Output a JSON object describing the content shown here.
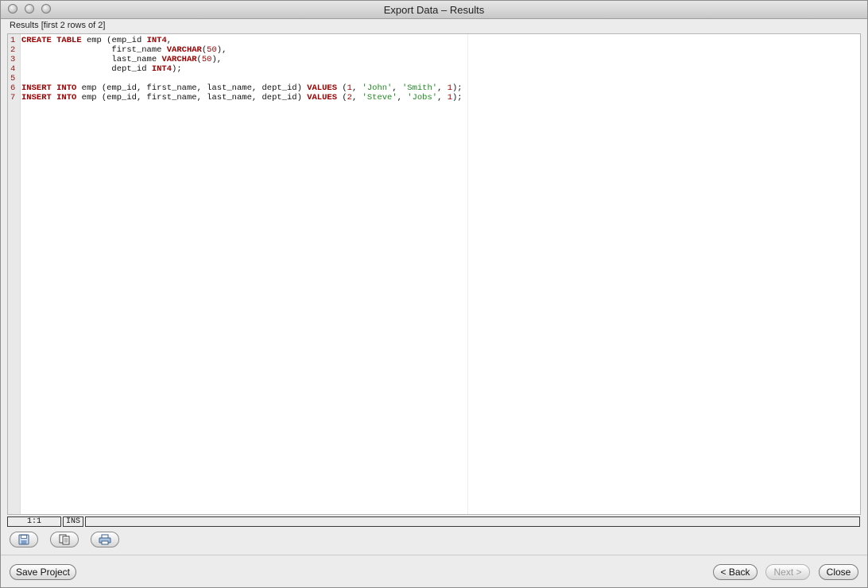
{
  "window": {
    "title": "Export Data – Results"
  },
  "results_label": "Results [first 2 rows of 2]",
  "editor": {
    "lines": [
      {
        "num": "1",
        "tokens": [
          {
            "t": "CREATE",
            "c": "kw"
          },
          {
            "t": " "
          },
          {
            "t": "TABLE",
            "c": "kw"
          },
          {
            "t": " emp (emp_id "
          },
          {
            "t": "INT4",
            "c": "kw"
          },
          {
            "t": ","
          }
        ]
      },
      {
        "num": "2",
        "tokens": [
          {
            "t": "                  first_name "
          },
          {
            "t": "VARCHAR",
            "c": "kw"
          },
          {
            "t": "("
          },
          {
            "t": "50",
            "c": "num"
          },
          {
            "t": "),"
          }
        ]
      },
      {
        "num": "3",
        "tokens": [
          {
            "t": "                  last_name "
          },
          {
            "t": "VARCHAR",
            "c": "kw"
          },
          {
            "t": "("
          },
          {
            "t": "50",
            "c": "num"
          },
          {
            "t": "),"
          }
        ]
      },
      {
        "num": "4",
        "tokens": [
          {
            "t": "                  dept_id "
          },
          {
            "t": "INT4",
            "c": "kw"
          },
          {
            "t": ");"
          }
        ]
      },
      {
        "num": "5",
        "tokens": []
      },
      {
        "num": "6",
        "tokens": [
          {
            "t": "INSERT",
            "c": "kw"
          },
          {
            "t": " "
          },
          {
            "t": "INTO",
            "c": "kw"
          },
          {
            "t": " emp (emp_id, first_name, last_name, dept_id) "
          },
          {
            "t": "VALUES",
            "c": "kw"
          },
          {
            "t": " ("
          },
          {
            "t": "1",
            "c": "num"
          },
          {
            "t": ", "
          },
          {
            "t": "'John'",
            "c": "str"
          },
          {
            "t": ", "
          },
          {
            "t": "'Smith'",
            "c": "str"
          },
          {
            "t": ", "
          },
          {
            "t": "1",
            "c": "num"
          },
          {
            "t": ");"
          }
        ]
      },
      {
        "num": "7",
        "tokens": [
          {
            "t": "INSERT",
            "c": "kw"
          },
          {
            "t": " "
          },
          {
            "t": "INTO",
            "c": "kw"
          },
          {
            "t": " emp (emp_id, first_name, last_name, dept_id) "
          },
          {
            "t": "VALUES",
            "c": "kw"
          },
          {
            "t": " ("
          },
          {
            "t": "2",
            "c": "num"
          },
          {
            "t": ", "
          },
          {
            "t": "'Steve'",
            "c": "str"
          },
          {
            "t": ", "
          },
          {
            "t": "'Jobs'",
            "c": "str"
          },
          {
            "t": ", "
          },
          {
            "t": "1",
            "c": "num"
          },
          {
            "t": ");"
          }
        ]
      }
    ]
  },
  "status": {
    "position": "1:1",
    "mode": "INS",
    "message": ""
  },
  "toolbar": {
    "icons": [
      "save-icon",
      "copy-icon",
      "print-icon"
    ]
  },
  "buttons": {
    "save_project": "Save Project",
    "back": "< Back",
    "next": "Next >",
    "close": "Close"
  },
  "colors": {
    "keyword": "#9b0000",
    "string": "#1e8a1e",
    "line_number": "#8b1a1a"
  }
}
